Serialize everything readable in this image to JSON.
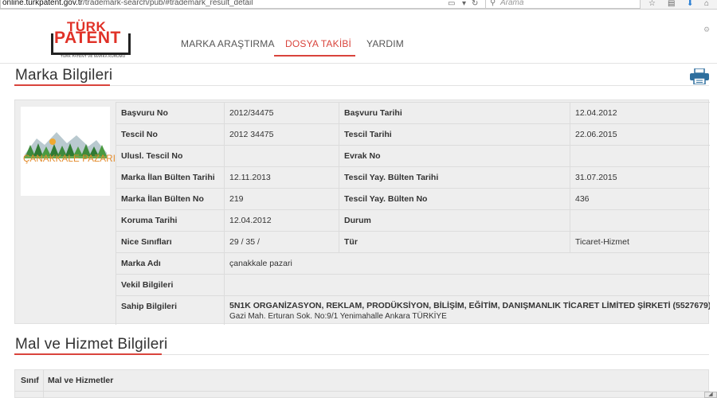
{
  "browser": {
    "url_domain": "online.turkpatent.gov.tr",
    "url_path": "/trademark-search/pub/#trademark_result_detail",
    "search_placeholder": "Arama"
  },
  "header": {
    "logo_top": "TÜRK",
    "logo_main": "PATENT",
    "logo_sub": "TÜRK PATENT VE MARKA KURUMU",
    "nav": [
      {
        "label": "MARKA ARAŞTIRMA",
        "active": false
      },
      {
        "label": "DOSYA TAKİBİ",
        "active": true
      },
      {
        "label": "YARDIM",
        "active": false
      }
    ]
  },
  "marka": {
    "section_title": "Marka Bilgileri",
    "logo_text": "ÇANAKKALE PAZARI",
    "rows": [
      {
        "l1": "Başvuru No",
        "v1": "2012/34475",
        "l2": "Başvuru Tarihi",
        "v2": "12.04.2012"
      },
      {
        "l1": "Tescil No",
        "v1": "2012 34475",
        "l2": "Tescil Tarihi",
        "v2": "22.06.2015"
      },
      {
        "l1": "Ulusl. Tescil No",
        "v1": "",
        "l2": "Evrak No",
        "v2": ""
      },
      {
        "l1": "Marka İlan Bülten Tarihi",
        "v1": "12.11.2013",
        "l2": "Tescil Yay. Bülten Tarihi",
        "v2": "31.07.2015"
      },
      {
        "l1": "Marka İlan Bülten No",
        "v1": "219",
        "l2": "Tescil Yay. Bülten No",
        "v2": "436"
      },
      {
        "l1": "Koruma Tarihi",
        "v1": "12.04.2012",
        "l2": "Durum",
        "v2": ""
      },
      {
        "l1": "Nice Sınıfları",
        "v1": "29 / 35 /",
        "l2": "Tür",
        "v2": "Ticaret-Hizmet"
      }
    ],
    "marka_adi_label": "Marka Adı",
    "marka_adi_value": "çanakkale pazari",
    "vekil_label": "Vekil Bilgileri",
    "vekil_value": "",
    "sahip_label": "Sahip Bilgileri",
    "sahip_name": "5N1K ORGANİZASYON, REKLAM, PRODÜKSİYON, BİLİŞİM, EĞİTİM, DANIŞMANLIK TİCARET LİMİTED ŞİRKETİ (5527679)",
    "sahip_address": "Gazi Mah. Erturan Sok. No:9/1 Yenimahalle Ankara TÜRKİYE"
  },
  "mal_hizmet": {
    "section_title": "Mal ve Hizmet Bilgileri",
    "col_sinif": "Sınıf",
    "col_mal": "Mal ve Hizmetler"
  },
  "colors": {
    "accent": "#d9443c",
    "panel_bg": "#eeeeee"
  }
}
